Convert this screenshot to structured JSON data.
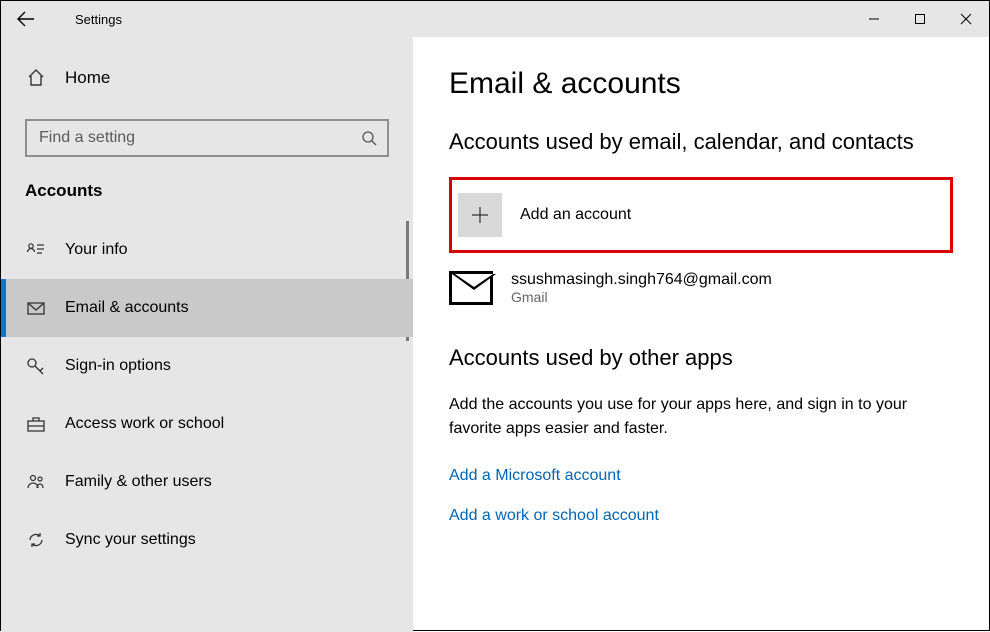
{
  "titlebar": {
    "title": "Settings"
  },
  "sidebar": {
    "home": "Home",
    "search_placeholder": "Find a setting",
    "section": "Accounts",
    "items": [
      {
        "label": "Your info"
      },
      {
        "label": "Email & accounts"
      },
      {
        "label": "Sign-in options"
      },
      {
        "label": "Access work or school"
      },
      {
        "label": "Family & other users"
      },
      {
        "label": "Sync your settings"
      }
    ]
  },
  "content": {
    "title": "Email & accounts",
    "email_section_heading": "Accounts used by email, calendar, and contacts",
    "add_account_label": "Add an account",
    "account_email": "ssushmasingh.singh764@gmail.com",
    "account_provider": "Gmail",
    "other_apps_heading": "Accounts used by other apps",
    "other_apps_desc": "Add the accounts you use for your apps here, and sign in to your favorite apps easier and faster.",
    "link_ms": "Add a Microsoft account",
    "link_work": "Add a work or school account"
  }
}
